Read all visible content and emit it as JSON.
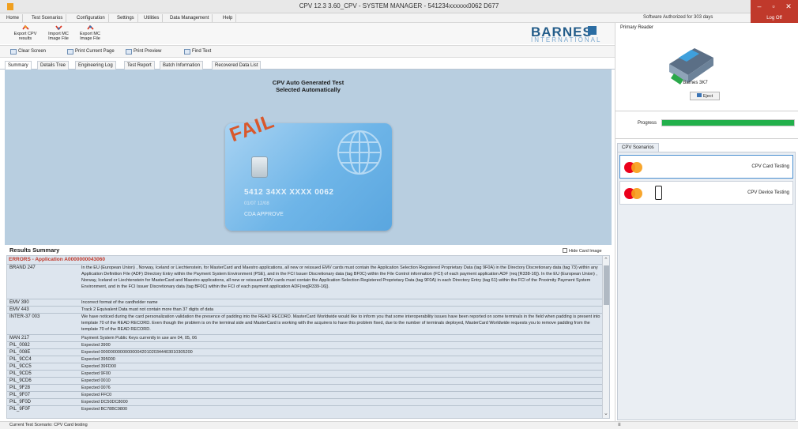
{
  "window": {
    "title": "CPV 12.3   3.60_CPV - SYSTEM MANAGER - 541234xxxxxx0062 D677",
    "minimize": "–",
    "maximize": "▫",
    "close": "✕"
  },
  "menu": [
    "Home",
    "Test Scenarios",
    "Configuration",
    "Settings",
    "Utilities",
    "Data Management",
    "Help"
  ],
  "auth": {
    "text": "Software Authorized for 303 days",
    "logoff": "Log Off"
  },
  "ribbon": {
    "export": "Export CPV results",
    "import": "Import MC Image File",
    "export_img": "Export MC Image File"
  },
  "logo": {
    "name": "BARNES",
    "sub": "INTERNATIONAL"
  },
  "toolbar": {
    "clear": "Clear Screen",
    "print_page": "Print Current Page",
    "print_preview": "Print Preview",
    "find": "Find Text"
  },
  "tabs": [
    "Summary",
    "Details Tree",
    "Engineering Log",
    "Test Report",
    "Batch Information",
    "Recovered Data List"
  ],
  "test": {
    "title": "CPV Auto Generated Test",
    "subtitle": "Selected Automatically"
  },
  "card": {
    "status": "FAIL",
    "pan": "5412 34XX XXXX 0062",
    "expiry": "01/07   12/08",
    "cda": "CDA APPROVE"
  },
  "results": {
    "header": "Results Summary",
    "hide_image": "Hide Card Image",
    "error_header": "ERRORS - Application A0000000043060",
    "rows": [
      {
        "code": "BRAND 247",
        "desc": "In the EU (European Union) , Norway, Iceland or Liechtenstein, for MasterCard and Maestro applications, all new or reissued EMV cards must contain the Application Selection Registered Proprietary Data (tag 9F0A) in the Directory Discretionary data (tag 73) within any Application Definition File (ADF) Directory Entry within the Payment System Environment (PSE), and in the FCI Issuer Discretionary data (tag BF0C) within the File Control information (FCI) of each payment application ADF (req [R338-16]). In the EU (European Union) , Norway, Iceland or Liechtenstein for MasterCard and Maestro applications, all new or reissued EMV cards must contain the Application Selection Registered Proprietary Data (tag 9F0A) in each Directory Entry (tag 61) within the FCI of the Proximity Payment System Environment, and in the FCI Issuer Discretionary data (tag BF0C) within the FCI of each payment application ADF(req[R339-16])."
      },
      {
        "code": "EMV 390",
        "desc": "Incorrect format of the cardholder name"
      },
      {
        "code": "EMV 443",
        "desc": "Track 2 Equivalent Data must not contain more than 37 digits of data"
      },
      {
        "code": "INTER-37 003",
        "desc": "We have noticed during the card personalization validation the presence of padding into the READ RECORD. MasterCard Worldwide would like to inform you that some interoperability issues have been reported on some terminals in the field when padding is present into template 70 of the READ RECORD. Even though the problem is on the terminal side and MasterCard is working with the acquirers to have this problem fixed, due to the number of terminals deployed, MasterCard Worldwide requests you to remove padding from the template 70 of the READ RECORD."
      },
      {
        "code": "MAN 217",
        "desc": "Payment System Public Keys currently in use are 04, 05, 06"
      },
      {
        "code": "PIL_0082",
        "desc": "Expected 3900"
      },
      {
        "code": "PIL_008E",
        "desc": "Expected 00000000000000004201020344403010305200"
      },
      {
        "code": "PIL_9CC4",
        "desc": "Expected 395000"
      },
      {
        "code": "PIL_9CC5",
        "desc": "Expected 39FD00"
      },
      {
        "code": "PIL_9CD5",
        "desc": "Expected 9F00"
      },
      {
        "code": "PIL_9CD6",
        "desc": "Expected 0010"
      },
      {
        "code": "PIL_9F28",
        "desc": "Expected 0076"
      },
      {
        "code": "PIL_9F07",
        "desc": "Expected FFC0"
      },
      {
        "code": "PIL_9F0D",
        "desc": "Expected DC50DC8000"
      },
      {
        "code": "PIL_9F0F",
        "desc": "Expected BC78BC9800"
      }
    ]
  },
  "panel": {
    "primary_reader": "Primary Reader",
    "reader_name": "Barnes 3K7",
    "eject": "Eject",
    "progress_label": "Progress",
    "progress_value": 1.0,
    "progress_color": "#22b04b",
    "scenarios_tab": "CPV Scenarios",
    "scenarios": [
      {
        "label": "CPV Card Testing",
        "icon": "mastercard-icon"
      },
      {
        "label": "CPV Device Testing",
        "icon": "mastercard-phone-icon"
      }
    ]
  },
  "status": {
    "label": "Current Test Scenario:",
    "value": "CPV Card testing",
    "right": "≡"
  },
  "colors": {
    "accent": "#c0392b",
    "brand": "#245d8a",
    "card_bg": "#b8cee0"
  }
}
